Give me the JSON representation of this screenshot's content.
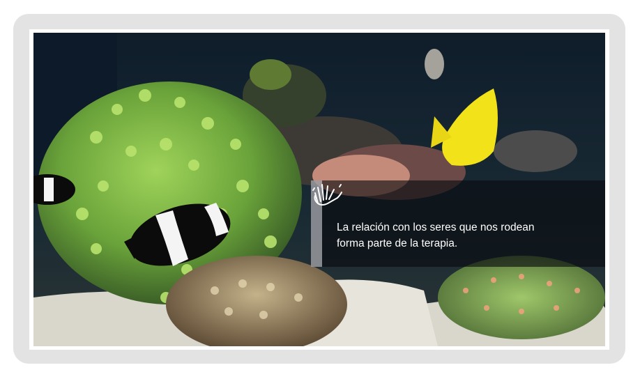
{
  "image": {
    "description_icon": "waving-hand-icon"
  },
  "caption": {
    "line1": "La relación con los seres que nos rodean",
    "line2": "forma parte de la terapia."
  },
  "colors": {
    "frame": "#e3e3e3",
    "panel": "rgba(8,10,14,0.62)",
    "text": "#ffffff"
  }
}
